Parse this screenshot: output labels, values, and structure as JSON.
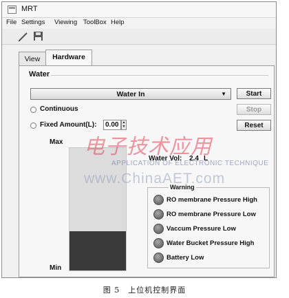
{
  "window": {
    "title": "MRT"
  },
  "menu": [
    "File",
    "Settings",
    "Viewing",
    "ToolBox",
    "Help"
  ],
  "toolbar": {
    "pen_icon": "pen-icon",
    "save_icon": "save-icon"
  },
  "tabs": [
    {
      "label": "View",
      "active": false
    },
    {
      "label": "Hardware",
      "active": true
    }
  ],
  "water": {
    "group_title": "Water",
    "mode_select": "Water In",
    "start_label": "Start",
    "stop_label": "Stop",
    "reset_label": "Reset",
    "continuous_label": "Continuous",
    "fixed_label": "Fixed Amount(L):",
    "fixed_value": "0.00",
    "tank_max_label": "Max",
    "tank_min_label": "Min",
    "tank_level_fraction": 0.32,
    "vol_label": "Water Vol:",
    "vol_value": "2.4",
    "vol_unit": "L"
  },
  "warning": {
    "title": "Warning",
    "items": [
      "RO membrane Pressure High",
      "RO membrane Pressure Low",
      "Vaccum Pressure Low",
      "Water Bucket Pressure High",
      "Battery Low"
    ]
  },
  "watermark": {
    "logo": "电子技术应用",
    "text": "APPLICATION OF ELECTRONIC TECHNIQUE",
    "url": "www.ChinaAET.com"
  },
  "caption": "图 5　上位机控制界面",
  "colors": {
    "tank_fill": "#3a3a3a",
    "tank_empty": "#dcdcdc",
    "led_off": "#7a7a7a"
  }
}
